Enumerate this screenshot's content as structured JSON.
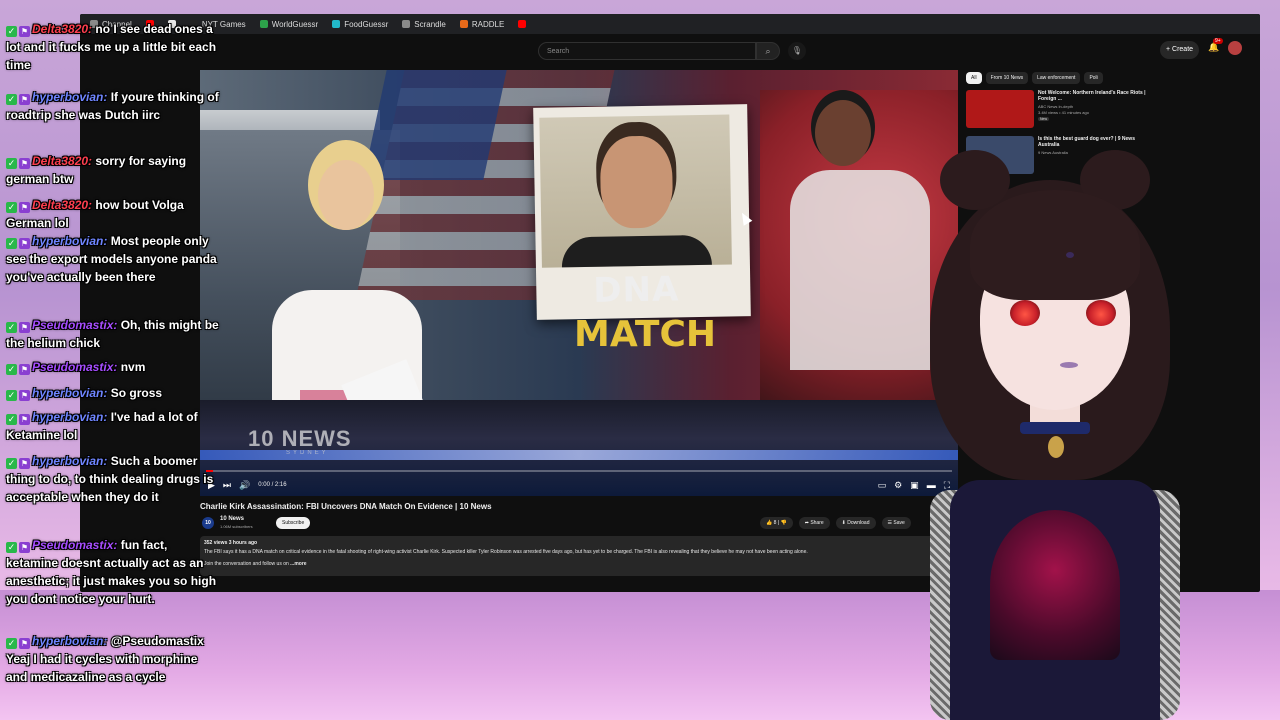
{
  "bookmarks": [
    {
      "label": "Channel",
      "icon": "folder-icon",
      "color": "#8a8a8a"
    },
    {
      "label": "",
      "icon": "youtube-icon",
      "color": "#ff0000"
    },
    {
      "label": "",
      "icon": "x-icon",
      "color": "#e8e8e8"
    },
    {
      "label": "NYT Games",
      "icon": "nyt-icon",
      "color": "#222222"
    },
    {
      "label": "WorldGuessr",
      "icon": "worldguessr-icon",
      "color": "#2da24a"
    },
    {
      "label": "FoodGuessr",
      "icon": "foodguessr-icon",
      "color": "#22b8c8"
    },
    {
      "label": "Scrandle",
      "icon": "scrandle-icon",
      "color": "#8a8a8a"
    },
    {
      "label": "RADDLE",
      "icon": "raddle-icon",
      "color": "#e86a1a"
    },
    {
      "label": "",
      "icon": "youtube-icon",
      "color": "#ff0000"
    }
  ],
  "youtube": {
    "search_placeholder": "Search",
    "create_label": "+ Create",
    "notifications": "9+"
  },
  "video": {
    "overlay_dna": "DNA",
    "overlay_match": "MATCH",
    "news_logo": "10 NEWS",
    "news_sub": "SYDNEY",
    "time": "0:00 / 2:16",
    "progress": 0.01,
    "title": "Charlie Kirk Assassination: FBI Uncovers DNA Match On Evidence | 10 News",
    "channel": "10 News",
    "subscribers": "1.06M subscribers",
    "subscribe_label": "Subscribe",
    "likes": "8",
    "share_label": "Share",
    "download_label": "Download",
    "save_label": "Save",
    "description_meta": "352 views  3 hours ago",
    "description_text": "The FBI says it has a DNA match on critical evidence in the fatal shooting of right-wing activist Charlie Kirk. Suspected killer Tyler Robinson was arrested five days ago, but has yet to be charged. The FBI is also revealing that they believe he may not have been acting alone.",
    "description_more_prefix": "Join the conversation and follow us on",
    "description_more": "...more"
  },
  "sidebar": {
    "chips": [
      "All",
      "From 10 News",
      "Law enforcement",
      "Poli"
    ],
    "recommendations": [
      {
        "title": "Not Welcome: Northern Ireland's Race Riots | Foreign ...",
        "channel": "ABC News In-depth",
        "meta": "3.4M views • 41 minutes ago",
        "badge": "New",
        "thumb_color": "#b01818"
      },
      {
        "title": "Is this the best guard dog ever? | 9 News Australia",
        "channel": "9 News Australia",
        "meta": "",
        "badge": "",
        "thumb_color": "#3a4a6a"
      }
    ]
  },
  "chat": [
    {
      "user": "Delta3820",
      "style": "delta",
      "text": "no I see dead ones a lot and it fucks me up a little bit each time"
    },
    {
      "user": "hyperbovian",
      "style": "hyper",
      "text": "If youre thinking of roadtrip she was Dutch iirc"
    },
    {
      "user": "Delta3820",
      "style": "delta",
      "text": "sorry for saying german btw"
    },
    {
      "user": "Delta3820",
      "style": "delta",
      "text": "how bout Volga German lol"
    },
    {
      "user": "hyperbovian",
      "style": "hyper",
      "text": "Most people only see the export models anyone panda you've actually been there"
    },
    {
      "user": "Pseudomastix",
      "style": "pseudo",
      "text": "Oh, this might be the helium chick"
    },
    {
      "user": "Pseudomastix",
      "style": "pseudo",
      "text": "nvm"
    },
    {
      "user": "hyperbovian",
      "style": "hyper",
      "text": "So gross"
    },
    {
      "user": "hyperbovian",
      "style": "hyper",
      "text": "I've had a lot of Ketamine lol"
    },
    {
      "user": "hyperbovian",
      "style": "hyper",
      "text": "Such a boomer thing to do, to think dealing drugs is acceptable when they do it"
    },
    {
      "user": "Pseudomastix",
      "style": "pseudo",
      "text": "fun fact, ketamine doesnt actually act as an anesthetic; it just makes you so high you dont notice your hurt."
    },
    {
      "user": "hyperbovian",
      "style": "hyper",
      "text": "@Pseudomastix Yeaj I had it cycles with morphine and medicazaline as a cycle"
    }
  ]
}
